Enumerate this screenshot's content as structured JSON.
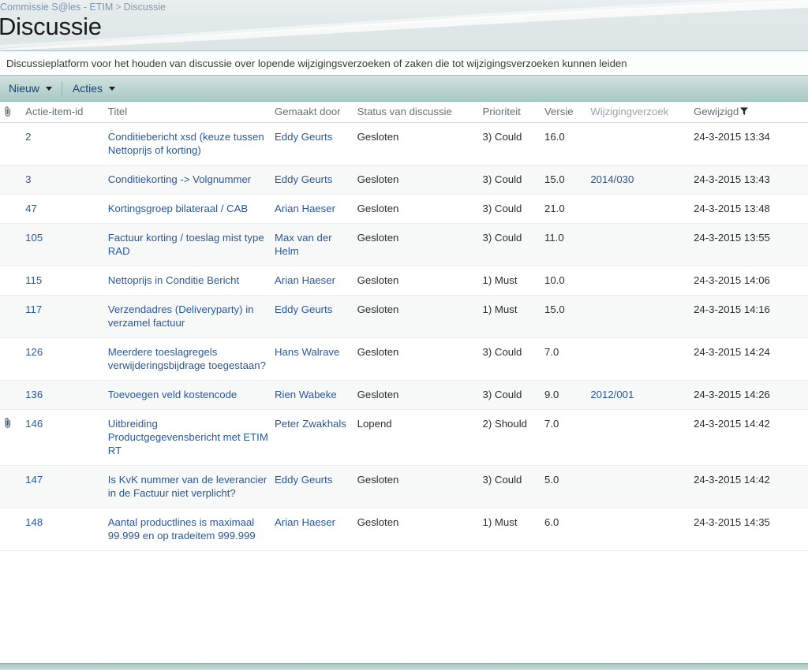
{
  "header": {
    "breadcrumb": {
      "root": "Commissie S@les - ETIM",
      "separator": ">",
      "current": "Discussie"
    },
    "title": "Discussie"
  },
  "description": "Discussieplatform voor het houden van discussie over lopende wijzigingsverzoeken of zaken die tot wijzigingsverzoeken kunnen leiden",
  "toolbar": {
    "new_label": "Nieuw",
    "actions_label": "Acties"
  },
  "table": {
    "columns": {
      "attachment": "",
      "id": "Actie-item-id",
      "title": "Titel",
      "created_by": "Gemaakt door",
      "status": "Status van discussie",
      "priority": "Prioriteit",
      "version": "Versie",
      "change_request": "Wijzigingverzoek",
      "modified": "Gewijzigd"
    },
    "rows": [
      {
        "attachment": false,
        "id": "2",
        "title": "Conditiebericht xsd (keuze tussen Nettoprijs of korting)",
        "created_by": "Eddy Geurts",
        "status": "Gesloten",
        "priority": "3) Could",
        "version": "16.0",
        "change_request": "",
        "modified": "24-3-2015 13:34"
      },
      {
        "attachment": false,
        "id": "3",
        "title": "Conditiekorting -> Volgnummer",
        "created_by": "Eddy Geurts",
        "status": "Gesloten",
        "priority": "3) Could",
        "version": "15.0",
        "change_request": "2014/030",
        "modified": "24-3-2015 13:43"
      },
      {
        "attachment": false,
        "id": "47",
        "title": "Kortingsgroep bilateraal / CAB",
        "created_by": "Arian Haeser",
        "status": "Gesloten",
        "priority": "3) Could",
        "version": "21.0",
        "change_request": "",
        "modified": "24-3-2015 13:48"
      },
      {
        "attachment": false,
        "id": "105",
        "title": "Factuur korting / toeslag mist type RAD",
        "created_by": "Max van der Helm",
        "status": "Gesloten",
        "priority": "3) Could",
        "version": "11.0",
        "change_request": "",
        "modified": "24-3-2015 13:55"
      },
      {
        "attachment": false,
        "id": "115",
        "title": "Nettoprijs in Conditie Bericht",
        "created_by": "Arian Haeser",
        "status": "Gesloten",
        "priority": "1) Must",
        "version": "10.0",
        "change_request": "",
        "modified": "24-3-2015 14:06"
      },
      {
        "attachment": false,
        "id": "117",
        "title": "Verzendadres (Deliveryparty) in verzamel factuur",
        "created_by": "Eddy Geurts",
        "status": "Gesloten",
        "priority": "1) Must",
        "version": "15.0",
        "change_request": "",
        "modified": "24-3-2015 14:16"
      },
      {
        "attachment": false,
        "id": "126",
        "title": "Meerdere toeslagregels verwijderingsbijdrage toegestaan?",
        "created_by": "Hans Walrave",
        "status": "Gesloten",
        "priority": "3) Could",
        "version": "7.0",
        "change_request": "",
        "modified": "24-3-2015 14:24"
      },
      {
        "attachment": false,
        "id": "136",
        "title": "Toevoegen veld kostencode",
        "created_by": "Rien Wabeke",
        "status": "Gesloten",
        "priority": "3) Could",
        "version": "9.0",
        "change_request": "2012/001",
        "modified": "24-3-2015 14:26"
      },
      {
        "attachment": true,
        "id": "146",
        "title": "Uitbreiding Productgegevensbericht met ETIM RT",
        "created_by": "Peter Zwakhals",
        "status": "Lopend",
        "priority": "2) Should",
        "version": "7.0",
        "change_request": "",
        "modified": "24-3-2015 14:42"
      },
      {
        "attachment": false,
        "id": "147",
        "title": "Is KvK nummer van de leverancier in de Factuur niet verplicht?",
        "created_by": "Eddy Geurts",
        "status": "Gesloten",
        "priority": "3) Could",
        "version": "5.0",
        "change_request": "",
        "modified": "24-3-2015 14:42"
      },
      {
        "attachment": false,
        "id": "148",
        "title": "Aantal productlines is maximaal 99.999 en op tradeitem 999.999",
        "created_by": "Arian Haeser",
        "status": "Gesloten",
        "priority": "1) Must",
        "version": "6.0",
        "change_request": "",
        "modified": "24-3-2015 14:35"
      }
    ]
  },
  "icons": {
    "attachment": "paperclip-icon",
    "filter": "filter-funnel-icon",
    "dropdown": "chevron-down-icon"
  },
  "colors": {
    "link": "#2b5799",
    "banner_start": "#e9eeee",
    "banner_end": "#dce5e4",
    "toolbar_start": "#d3e3e0",
    "toolbar_end": "#a9cac5",
    "border_teal": "#a8c3c3"
  }
}
